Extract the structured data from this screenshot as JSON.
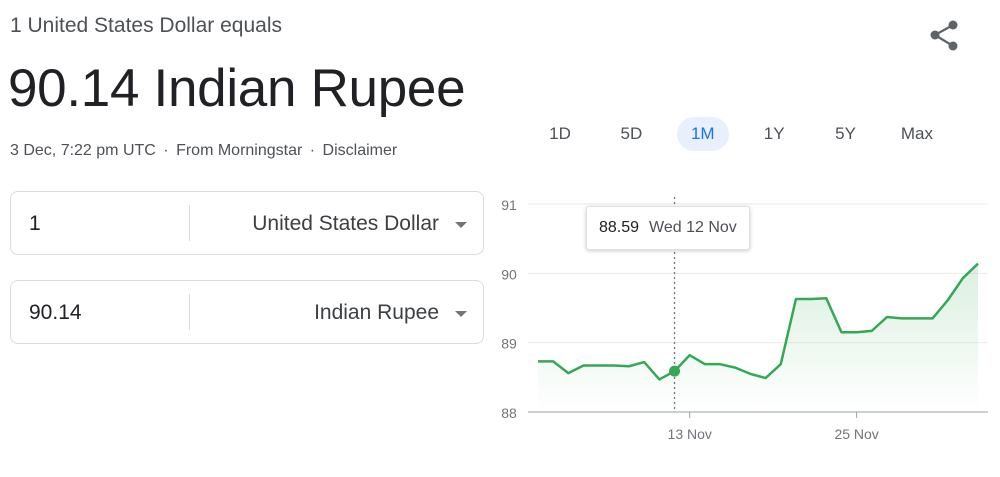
{
  "header": {
    "subtitle": "1 United States Dollar equals",
    "value": "90.14 Indian Rupee",
    "timestamp": "3 Dec, 7:22 pm UTC",
    "source": "From Morningstar",
    "disclaimer": "Disclaimer",
    "separator": "·"
  },
  "converter": {
    "from": {
      "amount": "1",
      "currency": "United States Dollar"
    },
    "to": {
      "amount": "90.14",
      "currency": "Indian Rupee"
    }
  },
  "range_tabs": [
    "1D",
    "5D",
    "1M",
    "1Y",
    "5Y",
    "Max"
  ],
  "active_range": "1M",
  "tooltip": {
    "value": "88.59",
    "date": "Wed 12 Nov"
  },
  "colors": {
    "line": "#34a853",
    "accent": "#1a73e8",
    "active_tab_bg": "#e8f0fe"
  },
  "icons": {
    "share": "share-icon",
    "dropdown": "chevron-down-icon"
  },
  "chart_data": {
    "type": "line",
    "series": [
      {
        "values": [
          88.73,
          88.73,
          88.56,
          88.67,
          88.67,
          88.67,
          88.66,
          88.72,
          88.47,
          88.59,
          88.82,
          88.69,
          88.69,
          88.64,
          88.55,
          88.49,
          88.69,
          89.63,
          89.63,
          89.64,
          89.15,
          89.15,
          89.17,
          89.37,
          89.35,
          89.35,
          89.35,
          89.61,
          89.93,
          90.14
        ]
      }
    ],
    "xtick_labels": [
      "13 Nov",
      "25 Nov"
    ],
    "xtick_index": [
      10,
      21
    ],
    "yticks": [
      88,
      89,
      90,
      91
    ],
    "ylim": [
      88,
      91
    ],
    "highlight_index": 9,
    "grid": true
  }
}
